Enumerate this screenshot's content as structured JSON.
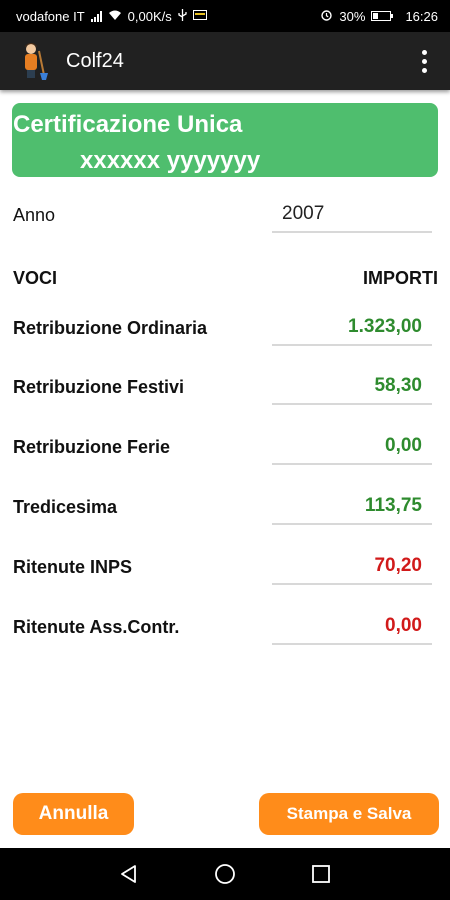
{
  "status_bar": {
    "carrier": "vodafone IT",
    "data_speed": "0,00K/s",
    "battery_percent": "30%",
    "time": "16:26"
  },
  "action_bar": {
    "app_title": "Colf24",
    "icons": [
      "app-logo-icon",
      "overflow-menu-icon"
    ]
  },
  "header": {
    "title": "Certificazione Unica",
    "name": "xxxxxx yyyyyyy",
    "color": "#4fbe6e"
  },
  "form": {
    "anno_label": "Anno",
    "anno_value": "2007",
    "col_voci": "VOCI",
    "col_importi": "IMPORTI",
    "rows": [
      {
        "label": "Retribuzione Ordinaria",
        "value": "1.323,00",
        "color": "#2e8b2e"
      },
      {
        "label": "Retribuzione Festivi",
        "value": "58,30",
        "color": "#2e8b2e"
      },
      {
        "label": "Retribuzione Ferie",
        "value": "0,00",
        "color": "#2e8b2e"
      },
      {
        "label": "Tredicesima",
        "value": "113,75",
        "color": "#2e8b2e"
      },
      {
        "label": "Ritenute INPS",
        "value": "70,20",
        "color": "#d11a1a"
      },
      {
        "label": "Ritenute Ass.Contr.",
        "value": "0,00",
        "color": "#d11a1a"
      }
    ]
  },
  "buttons": {
    "cancel_label": "Annulla",
    "save_label": "Stampa e Salva",
    "color": "#ff8c1a"
  },
  "nav_bar": {
    "icons": [
      "back-icon",
      "home-icon",
      "recents-icon"
    ]
  }
}
